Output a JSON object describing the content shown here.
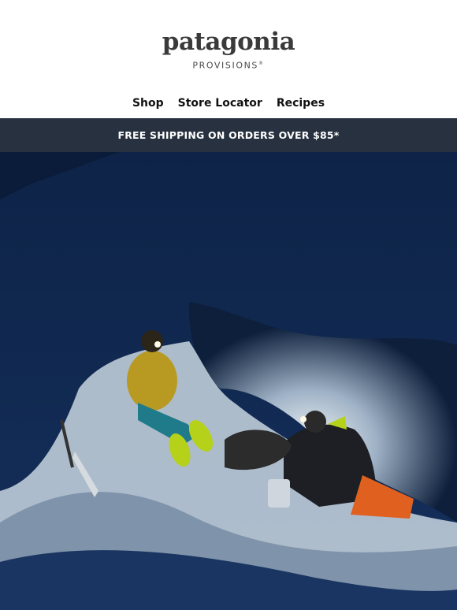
{
  "brand": {
    "wordmark": "patagonia",
    "subbrand": "PROVISIONS",
    "trademark": "®"
  },
  "nav": {
    "items": [
      {
        "label": "Shop"
      },
      {
        "label": "Store Locator"
      },
      {
        "label": "Recipes"
      }
    ]
  },
  "promo_banner": {
    "text": "FREE SHIPPING ON ORDERS OVER $85*"
  },
  "colors": {
    "banner_bg": "#27313f",
    "night_sky": "#0a1a33",
    "snow": "#e8eef2",
    "jacket_yellow": "#b89a22",
    "headlamp": "#fffbe6"
  },
  "hero": {
    "icon": "hero-photo-snow-cave"
  }
}
